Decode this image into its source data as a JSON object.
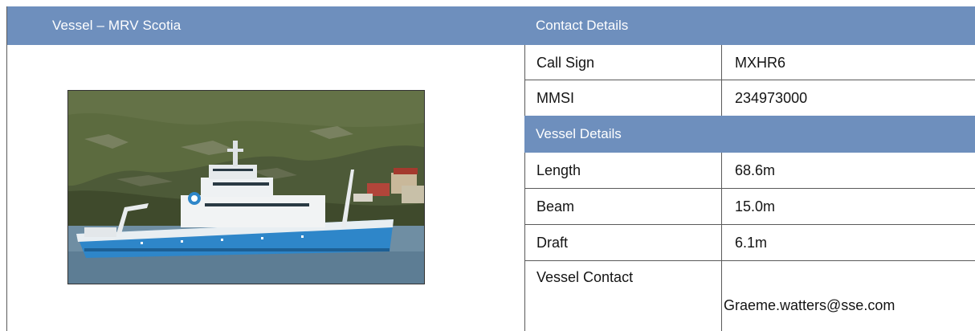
{
  "vessel_panel": {
    "header": "Vessel – MRV Scotia",
    "photo_alt": "MRV Scotia research vessel"
  },
  "contact_details": {
    "header": "Contact Details",
    "rows": [
      {
        "label": "Call Sign",
        "value": "MXHR6"
      },
      {
        "label": "MMSI",
        "value": "234973000"
      }
    ]
  },
  "vessel_details": {
    "header": "Vessel Details",
    "rows": [
      {
        "label": "Length",
        "value": "68.6m"
      },
      {
        "label": "Beam",
        "value": "15.0m"
      },
      {
        "label": "Draft",
        "value": "6.1m"
      },
      {
        "label": "Vessel Contact",
        "value": "Graeme.watters@sse.com"
      }
    ]
  },
  "colors": {
    "header_band": "#6e8fbd",
    "rule": "#5a5a5a",
    "hull_blue": "#2e86c9"
  }
}
